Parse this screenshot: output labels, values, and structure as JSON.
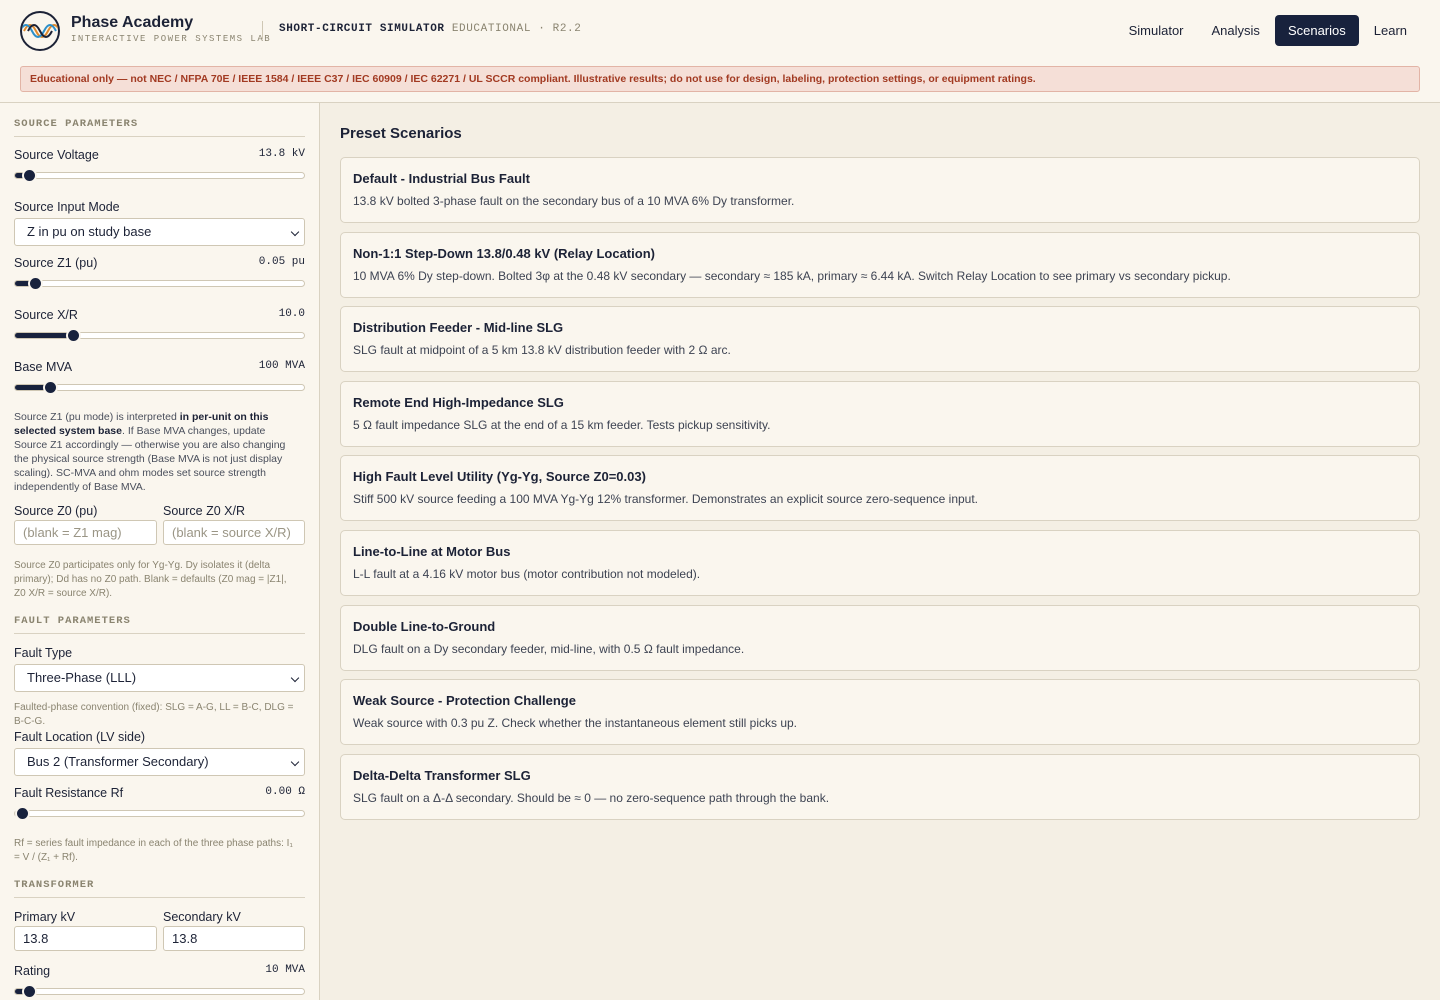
{
  "brand": {
    "name": "Phase Academy",
    "subtitle": "INTERACTIVE POWER SYSTEMS LAB",
    "app_title": "SHORT-CIRCUIT SIMULATOR",
    "app_edition": "EDUCATIONAL · R2.2"
  },
  "nav": {
    "items": [
      {
        "label": "Simulator",
        "active": false
      },
      {
        "label": "Analysis",
        "active": false
      },
      {
        "label": "Scenarios",
        "active": true
      },
      {
        "label": "Learn",
        "active": false
      }
    ]
  },
  "banner": "Educational only — not NEC / NFPA 70E / IEEE 1584 / IEEE C37 / IEC 60909 / IEC 62271 / UL SCCR compliant. Illustrative results; do not use for design, labeling, protection settings, or equipment ratings.",
  "sidebar": {
    "source": {
      "heading": "SOURCE PARAMETERS",
      "voltage": {
        "label": "Source Voltage",
        "value": "13.8 kV",
        "level": 0.05
      },
      "input_mode": {
        "label": "Source Input Mode",
        "selected": "Z in pu on study base"
      },
      "z1": {
        "label": "Source Z1 (pu)",
        "value": "0.05 pu",
        "level": 0.07
      },
      "xr": {
        "label": "Source X/R",
        "value": "10.0",
        "level": 0.2
      },
      "base_mva": {
        "label": "Base MVA",
        "value": "100 MVA",
        "level": 0.12
      },
      "note_a": "Source Z1 (pu mode) is interpreted ",
      "note_b": "in per-unit on this selected system base",
      "note_c": ". If Base MVA changes, update Source Z1 accordingly — otherwise you are also changing the physical source strength (Base MVA is not just display scaling). SC-MVA and ohm modes set source strength independently of Base MVA.",
      "z0": {
        "label": "Source Z0 (pu)",
        "placeholder": "(blank = Z1 mag)"
      },
      "z0xr": {
        "label": "Source Z0 X/R",
        "placeholder": "(blank = source X/R)"
      },
      "z0_note": "Source Z0 participates only for Yg-Yg. Dy isolates it (delta primary); Dd has no Z0 path. Blank = defaults (Z0 mag = |Z1|, Z0 X/R = source X/R)."
    },
    "fault": {
      "heading": "FAULT PARAMETERS",
      "type": {
        "label": "Fault Type",
        "selected": "Three-Phase (LLL)"
      },
      "phase_note": "Faulted-phase convention (fixed): SLG = A-G, LL = B-C, DLG = B-C-G.",
      "location": {
        "label": "Fault Location (LV side)",
        "selected": "Bus 2 (Transformer Secondary)"
      },
      "rf": {
        "label": "Fault Resistance Rf",
        "value": "0.00 Ω",
        "level": 0.0
      },
      "rf_note": "Rf = series fault impedance in each of the three phase paths: I₁ = V / (Z₁ + Rf)."
    },
    "transformer": {
      "heading": "TRANSFORMER",
      "primary": {
        "label": "Primary kV",
        "value": "13.8"
      },
      "secondary": {
        "label": "Secondary kV",
        "value": "13.8"
      },
      "rating": {
        "label": "Rating",
        "value": "10 MVA",
        "level": 0.05
      }
    }
  },
  "main": {
    "title": "Preset Scenarios",
    "scenarios": [
      {
        "title": "Default - Industrial Bus Fault",
        "desc": "13.8 kV bolted 3-phase fault on the secondary bus of a 10 MVA 6% Dy transformer."
      },
      {
        "title": "Non-1:1 Step-Down 13.8/0.48 kV (Relay Location)",
        "desc": "10 MVA 6% Dy step-down. Bolted 3φ at the 0.48 kV secondary — secondary ≈ 185 kA, primary ≈ 6.44 kA. Switch Relay Location to see primary vs secondary pickup."
      },
      {
        "title": "Distribution Feeder - Mid-line SLG",
        "desc": "SLG fault at midpoint of a 5 km 13.8 kV distribution feeder with 2 Ω arc."
      },
      {
        "title": "Remote End High-Impedance SLG",
        "desc": "5 Ω fault impedance SLG at the end of a 15 km feeder. Tests pickup sensitivity."
      },
      {
        "title": "High Fault Level Utility (Yg-Yg, Source Z0=0.03)",
        "desc": "Stiff 500 kV source feeding a 100 MVA Yg-Yg 12% transformer. Demonstrates an explicit source zero-sequence input."
      },
      {
        "title": "Line-to-Line at Motor Bus",
        "desc": "L-L fault at a 4.16 kV motor bus (motor contribution not modeled)."
      },
      {
        "title": "Double Line-to-Ground",
        "desc": "DLG fault on a Dy secondary feeder, mid-line, with 0.5 Ω fault impedance."
      },
      {
        "title": "Weak Source - Protection Challenge",
        "desc": "Weak source with 0.3 pu Z. Check whether the instantaneous element still picks up."
      },
      {
        "title": "Delta-Delta Transformer SLG",
        "desc": "SLG fault on a Δ-Δ secondary. Should be ≈ 0 — no zero-sequence path through the bank."
      }
    ]
  },
  "colors": {
    "accent": "#18223d",
    "background": "#f4efe4",
    "panel": "#faf6ee",
    "warning": "#a23a22"
  }
}
